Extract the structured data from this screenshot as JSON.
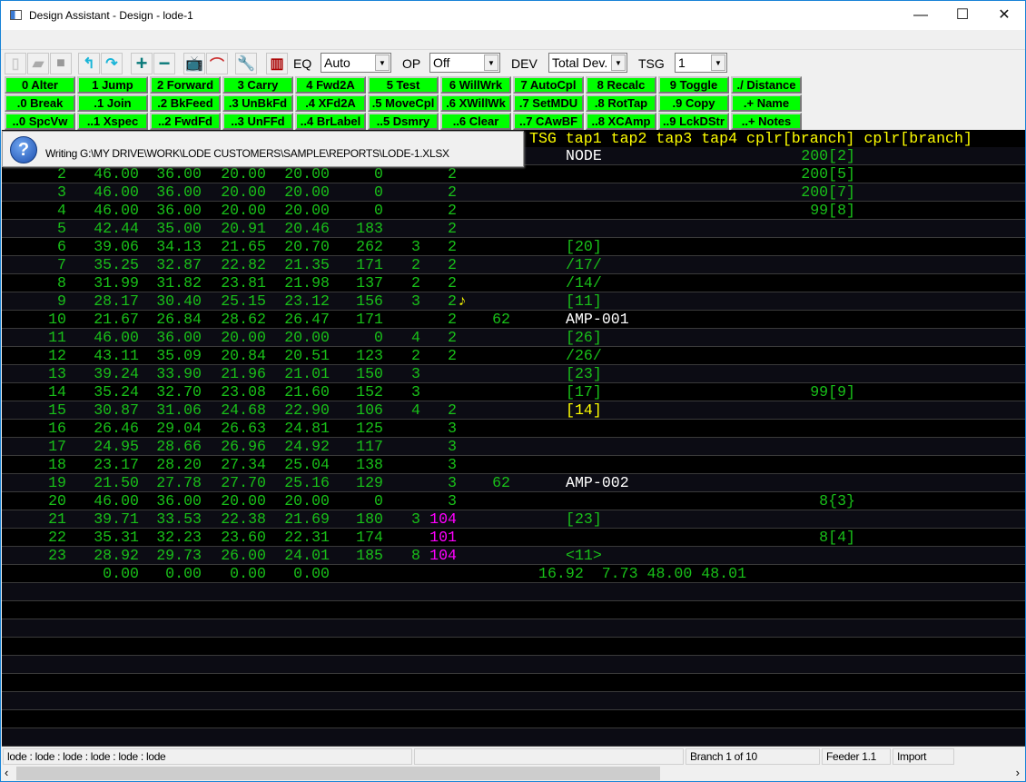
{
  "window": {
    "title": "Design Assistant - Design - lode-1",
    "controls": {
      "minimize": "—",
      "maximize": "☐",
      "close": "✕"
    }
  },
  "toolbar": {
    "icons": [
      "new-file-icon",
      "open-folder-icon",
      "save-icon",
      "undo-icon",
      "redo-icon",
      "plus-icon",
      "minus-icon",
      "tv-icon",
      "curve-tool-icon",
      "wrench-icon",
      "report-icon"
    ],
    "eq_label": "EQ",
    "eq_value": "Auto",
    "op_label": "OP",
    "op_value": "Off",
    "dev_label": "DEV",
    "dev_value": "Total Dev.",
    "tsg_label": "TSG",
    "tsg_value": "1"
  },
  "buttons": [
    [
      "0 Alter",
      "1 Jump",
      "2 Forward",
      "3 Carry",
      "4 Fwd2A",
      "5 Test",
      "6 WillWrk",
      "7 AutoCpl",
      "8 Recalc",
      "9 Toggle",
      "./ Distance"
    ],
    [
      ".0 Break",
      ".1 Join",
      ".2 BkFeed",
      ".3 UnBkFd",
      ".4 XFd2A",
      ".5 MoveCpl",
      ".6 XWillWk",
      ".7 SetMDU",
      ".8 RotTap",
      ".9 Copy",
      ".+ Name"
    ],
    [
      "..0 SpcVw",
      "..1 Xspec",
      "..2 FwdFd",
      "..3 UnFFd",
      "..4 BrLabel",
      "..5 Dsmry",
      "..6 Clear",
      "..7 CAwBF",
      "..8 XCAmp",
      "..9 LckDStr",
      "..+ Notes"
    ]
  ],
  "dialog": {
    "icon": "question-icon",
    "message": "Writing G:\\MY DRIVE\\WORK\\LODE CUSTOMERS\\SAMPLE\\REPORTS\\LODE-1.XLSX"
  },
  "grid": {
    "header": "TSG tap1 tap2 tap3 tap4 cplr[branch] cplr[branch]",
    "colors": {
      "green": "#19c019",
      "yellow": "#ffff00",
      "white": "#ffffff",
      "magenta": "#ff00ff"
    },
    "rows": [
      {
        "n": "",
        "v": [
          "",
          "",
          "",
          "",
          "",
          "",
          "",
          "",
          ""
        ],
        "name": "NODE",
        "name_color": "white",
        "cplr": "200[2]"
      },
      {
        "n": "2",
        "v": [
          "46.00",
          "36.00",
          "20.00",
          "20.00",
          "0",
          "",
          "2",
          ""
        ],
        "name": "",
        "cplr": "200[5]"
      },
      {
        "n": "3",
        "v": [
          "46.00",
          "36.00",
          "20.00",
          "20.00",
          "0",
          "",
          "2",
          ""
        ],
        "name": "",
        "cplr": "200[7]"
      },
      {
        "n": "4",
        "v": [
          "46.00",
          "36.00",
          "20.00",
          "20.00",
          "0",
          "",
          "2",
          ""
        ],
        "name": "",
        "cplr": "99[8]"
      },
      {
        "n": "5",
        "v": [
          "42.44",
          "35.00",
          "20.91",
          "20.46",
          "183",
          "",
          "2",
          ""
        ],
        "name": "",
        "cplr": ""
      },
      {
        "n": "6",
        "v": [
          "39.06",
          "34.13",
          "21.65",
          "20.70",
          "262",
          "3",
          "2",
          ""
        ],
        "name": "[20]",
        "cplr": ""
      },
      {
        "n": "7",
        "v": [
          "35.25",
          "32.87",
          "22.82",
          "21.35",
          "171",
          "2",
          "2",
          ""
        ],
        "name": "/17/",
        "cplr": ""
      },
      {
        "n": "8",
        "v": [
          "31.99",
          "31.82",
          "23.81",
          "21.98",
          "137",
          "2",
          "2",
          ""
        ],
        "name": "/14/",
        "cplr": ""
      },
      {
        "n": "9",
        "v": [
          "28.17",
          "30.40",
          "25.15",
          "23.12",
          "156",
          "3",
          "2",
          ""
        ],
        "name": "[11]",
        "cplr": "",
        "marker": "♪"
      },
      {
        "n": "10",
        "v": [
          "21.67",
          "26.84",
          "28.62",
          "26.47",
          "171",
          "",
          "2",
          "62"
        ],
        "name": "AMP-001",
        "name_color": "white",
        "cplr": ""
      },
      {
        "n": "11",
        "v": [
          "46.00",
          "36.00",
          "20.00",
          "20.00",
          "0",
          "4",
          "2",
          ""
        ],
        "name": "[26]",
        "cplr": ""
      },
      {
        "n": "12",
        "v": [
          "43.11",
          "35.09",
          "20.84",
          "20.51",
          "123",
          "2",
          "2",
          ""
        ],
        "name": "/26/",
        "cplr": ""
      },
      {
        "n": "13",
        "v": [
          "39.24",
          "33.90",
          "21.96",
          "21.01",
          "150",
          "3",
          "",
          ""
        ],
        "name": "[23]",
        "cplr": ""
      },
      {
        "n": "14",
        "v": [
          "35.24",
          "32.70",
          "23.08",
          "21.60",
          "152",
          "3",
          "",
          ""
        ],
        "name": "[17]",
        "cplr": "99[9]"
      },
      {
        "n": "15",
        "v": [
          "30.87",
          "31.06",
          "24.68",
          "22.90",
          "106",
          "4",
          "2",
          ""
        ],
        "name": "[14]",
        "name_color": "yellow",
        "cplr": ""
      },
      {
        "n": "16",
        "v": [
          "26.46",
          "29.04",
          "26.63",
          "24.81",
          "125",
          "",
          "3",
          ""
        ],
        "name": "",
        "cplr": ""
      },
      {
        "n": "17",
        "v": [
          "24.95",
          "28.66",
          "26.96",
          "24.92",
          "117",
          "",
          "3",
          ""
        ],
        "name": "",
        "cplr": ""
      },
      {
        "n": "18",
        "v": [
          "23.17",
          "28.20",
          "27.34",
          "25.04",
          "138",
          "",
          "3",
          ""
        ],
        "name": "",
        "cplr": ""
      },
      {
        "n": "19",
        "v": [
          "21.50",
          "27.78",
          "27.70",
          "25.16",
          "129",
          "",
          "3",
          "62"
        ],
        "name": "AMP-002",
        "name_color": "white",
        "cplr": ""
      },
      {
        "n": "20",
        "v": [
          "46.00",
          "36.00",
          "20.00",
          "20.00",
          "0",
          "",
          "3",
          ""
        ],
        "name": "",
        "cplr": "8{3}"
      },
      {
        "n": "21",
        "v": [
          "39.71",
          "33.53",
          "22.38",
          "21.69",
          "180",
          "3",
          "104",
          ""
        ],
        "v7_color": "magenta",
        "name": "[23]",
        "cplr": ""
      },
      {
        "n": "22",
        "v": [
          "35.31",
          "32.23",
          "23.60",
          "22.31",
          "174",
          "",
          "101",
          ""
        ],
        "v7_color": "magenta",
        "name": "",
        "cplr": "8[4]"
      },
      {
        "n": "23",
        "v": [
          "28.92",
          "29.73",
          "26.00",
          "24.01",
          "185",
          "8",
          "104",
          ""
        ],
        "v7_color": "magenta",
        "name": "<11>",
        "cplr": ""
      }
    ],
    "totals": {
      "v": [
        "0.00",
        "0.00",
        "0.00",
        "0.00"
      ],
      "summary": "16.92  7.73 48.00 48.01"
    }
  },
  "status": {
    "path": "lode : lode : lode : lode : lode : lode",
    "blank": "",
    "branch": "Branch 1 of 10",
    "feeder": "Feeder 1.1",
    "mode": "Import"
  },
  "scroll": {
    "left": "‹",
    "right": "›"
  }
}
